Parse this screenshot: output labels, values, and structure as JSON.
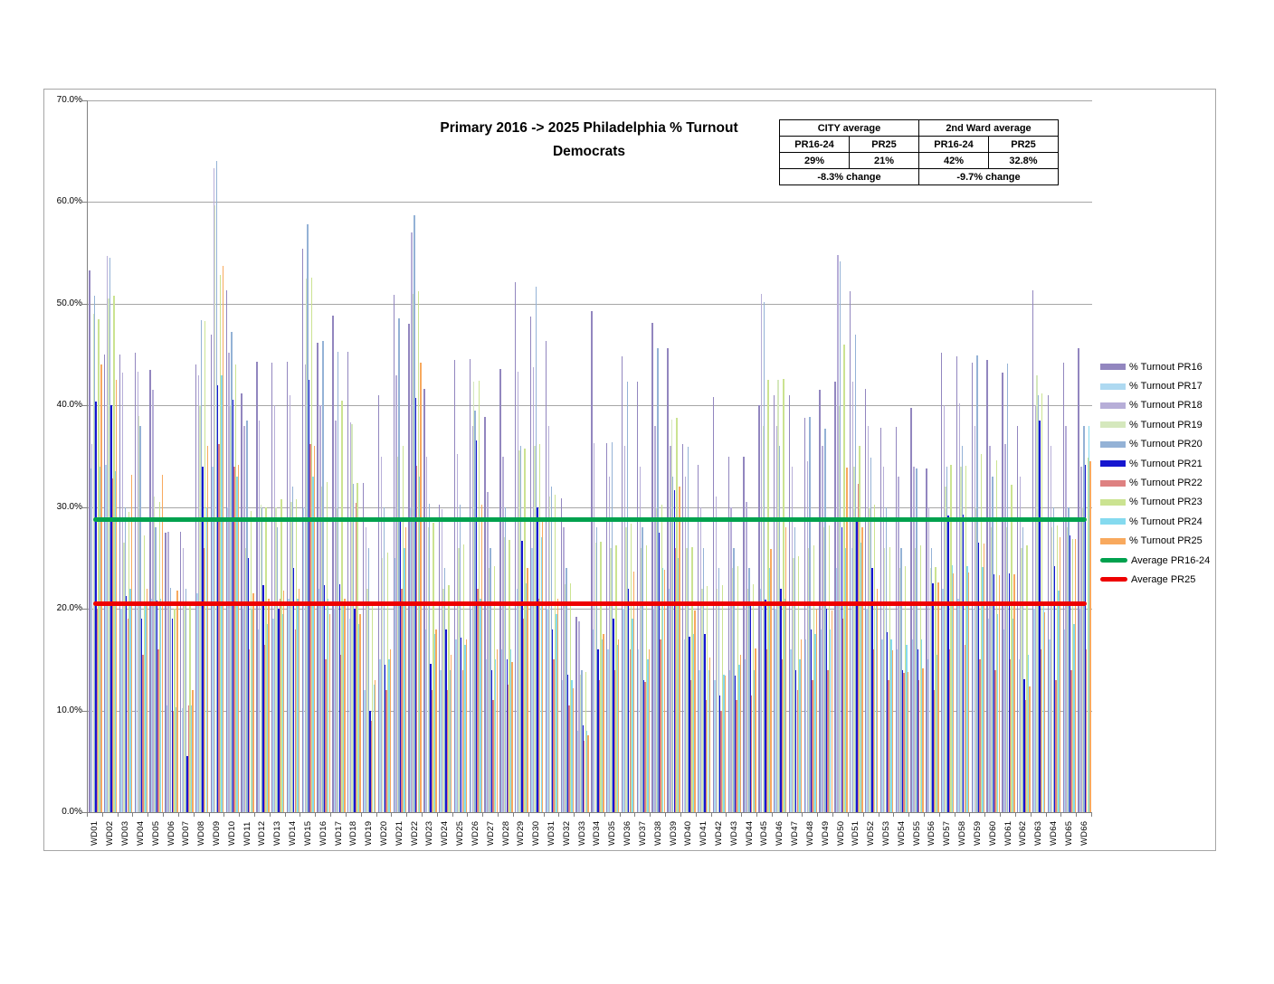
{
  "chart_data": {
    "type": "bar",
    "title": "Primary 2016 -> 2025 Philadelphia % Turnout",
    "subtitle": "Democrats",
    "xlabel": "",
    "ylabel": "",
    "ylim": [
      0,
      70
    ],
    "y_step": 10,
    "grid": true,
    "legend_position": "right",
    "y_axis_labels": [
      "0.0%",
      "10.0%",
      "20.0%",
      "30.0%",
      "40.0%",
      "50.0%",
      "60.0%",
      "70.0%"
    ],
    "categories": [
      "WD01",
      "WD02",
      "WD03",
      "WD04",
      "WD05",
      "WD06",
      "WD07",
      "WD08",
      "WD09",
      "WD10",
      "WD11",
      "WD12",
      "WD13",
      "WD14",
      "WD15",
      "WD16",
      "WD17",
      "WD18",
      "WD19",
      "WD20",
      "WD21",
      "WD22",
      "WD23",
      "WD24",
      "WD25",
      "WD26",
      "WD27",
      "WD28",
      "WD29",
      "WD30",
      "WD31",
      "WD32",
      "WD33",
      "WD34",
      "WD35",
      "WD36",
      "WD37",
      "WD38",
      "WD39",
      "WD40",
      "WD41",
      "WD42",
      "WD43",
      "WD44",
      "WD45",
      "WD46",
      "WD47",
      "WD48",
      "WD49",
      "WD50",
      "WD51",
      "WD52",
      "WD53",
      "WD54",
      "WD55",
      "WD56",
      "WD57",
      "WD58",
      "WD59",
      "WD60",
      "WD61",
      "WD62",
      "WD63",
      "WD64",
      "WD65",
      "WD66"
    ],
    "series": [
      {
        "name": "% Turnout PR16",
        "color": "#9286bf",
        "values": [
          53.3,
          45.0,
          45.0,
          45.2,
          43.5,
          27.5,
          27.6,
          44.0,
          47.0,
          51.3,
          41.2,
          44.3,
          44.2,
          44.3,
          55.4,
          46.2,
          48.8,
          45.3,
          32.4,
          41.0,
          50.9,
          48.0,
          41.6,
          30.2,
          44.5,
          44.6,
          38.9,
          43.6,
          52.1,
          48.7,
          46.3,
          30.9,
          19.2,
          49.3,
          36.3,
          44.8,
          42.3,
          48.1,
          45.6,
          36.2,
          34.2,
          40.8,
          35.0,
          35.0,
          40.0,
          41.0,
          41.0,
          38.8,
          41.5,
          42.3,
          51.2,
          41.6,
          37.8,
          37.9,
          39.8,
          33.8,
          45.2,
          44.8,
          44.2,
          44.5,
          43.2,
          38.0,
          51.3,
          41.0,
          44.2,
          45.6
        ]
      },
      {
        "name": "% Turnout PR17",
        "color": "#aed9f1",
        "values": [
          33.8,
          34.2,
          20.0,
          20.5,
          21.0,
          10.5,
          10.2,
          21.5,
          34.0,
          30.0,
          20.0,
          18.0,
          19.0,
          21.0,
          30.0,
          22.0,
          20.0,
          19.0,
          12.0,
          15.0,
          25.0,
          30.0,
          18.0,
          14.0,
          17.0,
          20.0,
          15.0,
          16.0,
          22.0,
          26.0,
          20.0,
          13.0,
          8.0,
          18.0,
          16.0,
          20.0,
          16.0,
          20.0,
          22.0,
          17.0,
          14.0,
          13.0,
          14.0,
          15.0,
          22.0,
          20.0,
          16.0,
          17.0,
          18.0,
          24.0,
          26.0,
          20.0,
          17.0,
          16.0,
          17.0,
          15.0,
          22.0,
          21.0,
          20.0,
          19.0,
          18.0,
          15.0,
          20.0,
          17.0,
          18.0,
          20.0
        ]
      },
      {
        "name": "% Turnout PR18",
        "color": "#b7aed8",
        "values": [
          36.2,
          54.7,
          43.2,
          43.3,
          41.5,
          27.6,
          26.0,
          43.0,
          63.3,
          45.2,
          38.0,
          38.5,
          40.0,
          41.0,
          44.0,
          40.0,
          38.5,
          38.3,
          28.0,
          35.0,
          43.0,
          57.0,
          35.0,
          29.8,
          35.2,
          38.0,
          31.5,
          35.0,
          43.3,
          43.8,
          38.0,
          28.0,
          18.8,
          36.3,
          33.0,
          36.0,
          34.0,
          38.0,
          36.0,
          33.0,
          30.0,
          31.0,
          30.0,
          30.5,
          51.0,
          38.0,
          34.0,
          34.5,
          36.0,
          54.8,
          42.3,
          38.0,
          34.0,
          33.0,
          34.0,
          30.0,
          40.0,
          40.2,
          38.0,
          36.0,
          36.2,
          33.0,
          40.0,
          36.0,
          38.0,
          34.0
        ]
      },
      {
        "name": "% Turnout PR19",
        "color": "#d5e8bd",
        "values": [
          49.0,
          50.5,
          26.5,
          39.0,
          31.0,
          20.3,
          20.5,
          40.0,
          59.7,
          40.0,
          26.0,
          30.2,
          30.0,
          30.5,
          52.5,
          32.0,
          30.0,
          38.2,
          22.0,
          25.0,
          35.0,
          51.0,
          28.0,
          22.0,
          26.0,
          42.3,
          24.0,
          27.0,
          35.6,
          36.0,
          31.0,
          22.4,
          13.5,
          26.5,
          26.0,
          28.0,
          26.0,
          30.0,
          38.6,
          26.0,
          22.0,
          22.0,
          24.0,
          22.0,
          38.0,
          42.5,
          25.0,
          26.0,
          28.0,
          40.0,
          34.0,
          30.0,
          26.0,
          24.0,
          26.0,
          24.0,
          32.0,
          34.0,
          30.0,
          28.0,
          28.0,
          26.0,
          43.0,
          28.0,
          28.0,
          30.0
        ]
      },
      {
        "name": "% Turnout PR20",
        "color": "#94b2d6",
        "values": [
          50.8,
          54.5,
          30.0,
          38.0,
          28.0,
          22.1,
          22.0,
          48.4,
          64.0,
          47.2,
          38.5,
          30.0,
          28.0,
          32.0,
          57.8,
          46.3,
          45.3,
          32.3,
          26.0,
          30.0,
          48.6,
          58.7,
          30.3,
          24.0,
          30.2,
          39.5,
          26.0,
          30.0,
          36.0,
          51.7,
          32.0,
          24.0,
          14.0,
          28.0,
          36.4,
          42.3,
          28.0,
          45.6,
          33.0,
          35.9,
          26.0,
          24.0,
          26.0,
          24.0,
          50.2,
          36.0,
          28.0,
          38.9,
          37.7,
          54.2,
          47.0,
          34.9,
          30.0,
          26.0,
          33.8,
          26.0,
          34.0,
          36.0,
          44.9,
          33.0,
          44.1,
          28.0,
          41.0,
          30.0,
          30.0,
          38.0
        ]
      },
      {
        "name": "% Turnout PR21",
        "color": "#1717cf",
        "values": [
          40.4,
          40.0,
          21.3,
          19.0,
          20.8,
          19.0,
          5.5,
          34.0,
          42.0,
          40.6,
          25.0,
          22.3,
          20.0,
          24.0,
          42.5,
          22.3,
          22.4,
          20.0,
          10.0,
          14.5,
          29.0,
          40.7,
          14.6,
          18.0,
          17.2,
          36.6,
          14.0,
          15.0,
          26.7,
          30.0,
          18.0,
          13.5,
          8.5,
          16.0,
          19.0,
          22.0,
          13.0,
          27.5,
          31.7,
          17.3,
          17.5,
          11.5,
          13.4,
          20.3,
          20.9,
          22.0,
          14.0,
          18.0,
          20.0,
          28.0,
          29.0,
          24.0,
          17.7,
          14.0,
          16.0,
          22.5,
          29.2,
          29.3,
          26.5,
          23.4,
          23.5,
          13.1,
          38.5,
          24.2,
          27.2,
          34.2
        ]
      },
      {
        "name": "% Turnout PR22",
        "color": "#de8181",
        "values": [
          20.0,
          32.8,
          19.0,
          15.5,
          16.0,
          10.0,
          10.5,
          26.0,
          36.2,
          34.0,
          16.0,
          16.5,
          21.0,
          18.0,
          36.2,
          15.0,
          15.5,
          30.4,
          9.0,
          12.0,
          22.0,
          34.1,
          12.0,
          12.0,
          14.0,
          22.0,
          11.0,
          12.5,
          19.0,
          21.0,
          15.0,
          10.5,
          7.0,
          13.0,
          14.0,
          16.0,
          12.8,
          17.0,
          26.0,
          13.0,
          11.0,
          10.0,
          11.0,
          11.5,
          16.0,
          15.0,
          12.0,
          13.0,
          14.0,
          19.0,
          32.3,
          16.0,
          13.0,
          13.7,
          13.0,
          12.0,
          16.0,
          16.5,
          15.0,
          14.0,
          15.0,
          11.0,
          16.0,
          13.0,
          14.0,
          16.0
        ]
      },
      {
        "name": "% Turnout PR23",
        "color": "#cbe391",
        "values": [
          48.5,
          50.8,
          29.5,
          27.2,
          30.5,
          20.0,
          20.5,
          48.3,
          52.8,
          44.0,
          29.6,
          30.0,
          30.8,
          30.8,
          52.6,
          32.5,
          40.5,
          32.4,
          20.5,
          25.5,
          36.0,
          51.2,
          28.5,
          22.3,
          26.3,
          42.4,
          24.2,
          26.8,
          35.8,
          36.2,
          31.2,
          22.5,
          13.8,
          26.6,
          26.2,
          28.4,
          26.2,
          30.2,
          38.8,
          26.1,
          22.2,
          22.3,
          24.2,
          22.4,
          42.5,
          42.6,
          25.2,
          26.2,
          28.2,
          46.0,
          36.0,
          30.2,
          26.1,
          24.2,
          26.2,
          24.1,
          34.2,
          34.1,
          35.2,
          34.6,
          32.2,
          26.2,
          41.2,
          28.2,
          26.9,
          34.9
        ]
      },
      {
        "name": "% Turnout PR24",
        "color": "#85daef",
        "values": [
          34.0,
          33.5,
          22.0,
          20.5,
          21.0,
          10.3,
          10.5,
          30.0,
          43.0,
          33.0,
          20.0,
          18.5,
          19.5,
          21.0,
          33.0,
          21.0,
          20.5,
          18.5,
          12.5,
          15.0,
          26.0,
          33.0,
          17.5,
          14.0,
          16.5,
          21.0,
          15.0,
          16.0,
          22.5,
          27.0,
          19.5,
          13.0,
          8.0,
          17.0,
          16.5,
          19.0,
          15.0,
          24.0,
          25.0,
          17.5,
          14.0,
          13.5,
          14.5,
          14.0,
          24.0,
          21.0,
          15.0,
          17.5,
          18.0,
          26.0,
          26.5,
          20.5,
          17.0,
          16.5,
          17.0,
          15.5,
          24.3,
          24.2,
          24.1,
          19.5,
          19.0,
          15.5,
          20.5,
          21.8,
          18.5,
          38.0
        ]
      },
      {
        "name": "% Turnout PR25",
        "color": "#f8a95e",
        "values": [
          44.0,
          42.5,
          33.2,
          22.0,
          33.2,
          21.8,
          12.0,
          36.0,
          53.7,
          34.2,
          21.5,
          21.0,
          21.8,
          22.0,
          36.0,
          19.5,
          21.0,
          19.5,
          13.0,
          16.0,
          28.0,
          44.2,
          18.0,
          15.5,
          17.0,
          30.2,
          16.0,
          14.8,
          24.0,
          29.0,
          21.0,
          12.2,
          7.6,
          17.5,
          17.0,
          23.7,
          16.0,
          23.8,
          32.0,
          19.8,
          15.2,
          13.4,
          15.5,
          16.1,
          25.9,
          28.0,
          17.0,
          19.9,
          19.8,
          33.9,
          28.0,
          22.0,
          15.9,
          13.8,
          14.1,
          22.6,
          23.5,
          23.6,
          26.4,
          23.3,
          23.4,
          12.4,
          19.7,
          27.0,
          26.9,
          34.5
        ]
      }
    ],
    "average_lines": [
      {
        "name": "Average PR16-24",
        "color": "#00a14e",
        "value": 28.8
      },
      {
        "name": "Average PR25",
        "color": "#ee0000",
        "value": 20.5
      }
    ]
  },
  "stats_table": {
    "groups": [
      {
        "header": "CITY average",
        "col1": "PR16-24",
        "col2": "PR25",
        "val1": "29%",
        "val2": "21%",
        "change": "-8.3% change"
      },
      {
        "header": "2nd Ward average",
        "col1": "PR16-24",
        "col2": "PR25",
        "val1": "42%",
        "val2": "32.8%",
        "change": "-9.7% change"
      }
    ]
  }
}
